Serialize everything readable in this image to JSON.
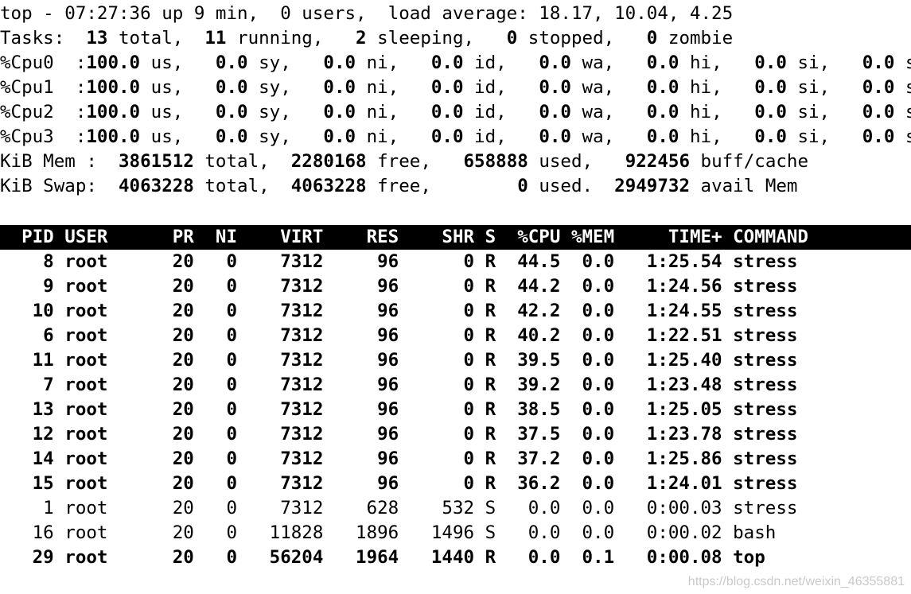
{
  "summary": {
    "uptime_line": "top - 07:27:36 up 9 min,  0 users,  load average: 18.17, 10.04, 4.25",
    "tasks": {
      "label": "Tasks:",
      "total": "13",
      "running": "11",
      "sleeping": "2",
      "stopped": "0",
      "zombie": "0"
    },
    "cpus": [
      {
        "name": "%Cpu0",
        "us": "100.0",
        "sy": "0.0",
        "ni": "0.0",
        "id": "0.0",
        "wa": "0.0",
        "hi": "0.0",
        "si": "0.0",
        "st": "0.0"
      },
      {
        "name": "%Cpu1",
        "us": "100.0",
        "sy": "0.0",
        "ni": "0.0",
        "id": "0.0",
        "wa": "0.0",
        "hi": "0.0",
        "si": "0.0",
        "st": "0.0"
      },
      {
        "name": "%Cpu2",
        "us": "100.0",
        "sy": "0.0",
        "ni": "0.0",
        "id": "0.0",
        "wa": "0.0",
        "hi": "0.0",
        "si": "0.0",
        "st": "0.0"
      },
      {
        "name": "%Cpu3",
        "us": "100.0",
        "sy": "0.0",
        "ni": "0.0",
        "id": "0.0",
        "wa": "0.0",
        "hi": "0.0",
        "si": "0.0",
        "st": "0.0"
      }
    ],
    "mem": {
      "label": "KiB Mem :",
      "total": "3861512",
      "free": "2280168",
      "used": "658888",
      "buff_cache": "922456"
    },
    "swap": {
      "label": "KiB Swap:",
      "total": "4063228",
      "free": "4063228",
      "used": "0",
      "avail_mem": "2949732"
    }
  },
  "process_table": {
    "columns": [
      "PID",
      "USER",
      "PR",
      "NI",
      "VIRT",
      "RES",
      "SHR",
      "S",
      "%CPU",
      "%MEM",
      "TIME+",
      "COMMAND"
    ],
    "rows": [
      {
        "pid": "8",
        "user": "root",
        "pr": "20",
        "ni": "0",
        "virt": "7312",
        "res": "96",
        "shr": "0",
        "s": "R",
        "cpu": "44.5",
        "mem": "0.0",
        "time": "1:25.54",
        "command": "stress",
        "bold": true
      },
      {
        "pid": "9",
        "user": "root",
        "pr": "20",
        "ni": "0",
        "virt": "7312",
        "res": "96",
        "shr": "0",
        "s": "R",
        "cpu": "44.2",
        "mem": "0.0",
        "time": "1:24.56",
        "command": "stress",
        "bold": true
      },
      {
        "pid": "10",
        "user": "root",
        "pr": "20",
        "ni": "0",
        "virt": "7312",
        "res": "96",
        "shr": "0",
        "s": "R",
        "cpu": "42.2",
        "mem": "0.0",
        "time": "1:24.55",
        "command": "stress",
        "bold": true
      },
      {
        "pid": "6",
        "user": "root",
        "pr": "20",
        "ni": "0",
        "virt": "7312",
        "res": "96",
        "shr": "0",
        "s": "R",
        "cpu": "40.2",
        "mem": "0.0",
        "time": "1:22.51",
        "command": "stress",
        "bold": true
      },
      {
        "pid": "11",
        "user": "root",
        "pr": "20",
        "ni": "0",
        "virt": "7312",
        "res": "96",
        "shr": "0",
        "s": "R",
        "cpu": "39.5",
        "mem": "0.0",
        "time": "1:25.40",
        "command": "stress",
        "bold": true
      },
      {
        "pid": "7",
        "user": "root",
        "pr": "20",
        "ni": "0",
        "virt": "7312",
        "res": "96",
        "shr": "0",
        "s": "R",
        "cpu": "39.2",
        "mem": "0.0",
        "time": "1:23.48",
        "command": "stress",
        "bold": true
      },
      {
        "pid": "13",
        "user": "root",
        "pr": "20",
        "ni": "0",
        "virt": "7312",
        "res": "96",
        "shr": "0",
        "s": "R",
        "cpu": "38.5",
        "mem": "0.0",
        "time": "1:25.05",
        "command": "stress",
        "bold": true
      },
      {
        "pid": "12",
        "user": "root",
        "pr": "20",
        "ni": "0",
        "virt": "7312",
        "res": "96",
        "shr": "0",
        "s": "R",
        "cpu": "37.5",
        "mem": "0.0",
        "time": "1:23.78",
        "command": "stress",
        "bold": true
      },
      {
        "pid": "14",
        "user": "root",
        "pr": "20",
        "ni": "0",
        "virt": "7312",
        "res": "96",
        "shr": "0",
        "s": "R",
        "cpu": "37.2",
        "mem": "0.0",
        "time": "1:25.86",
        "command": "stress",
        "bold": true
      },
      {
        "pid": "15",
        "user": "root",
        "pr": "20",
        "ni": "0",
        "virt": "7312",
        "res": "96",
        "shr": "0",
        "s": "R",
        "cpu": "36.2",
        "mem": "0.0",
        "time": "1:24.01",
        "command": "stress",
        "bold": true
      },
      {
        "pid": "1",
        "user": "root",
        "pr": "20",
        "ni": "0",
        "virt": "7312",
        "res": "628",
        "shr": "532",
        "s": "S",
        "cpu": "0.0",
        "mem": "0.0",
        "time": "0:00.03",
        "command": "stress",
        "bold": false
      },
      {
        "pid": "16",
        "user": "root",
        "pr": "20",
        "ni": "0",
        "virt": "11828",
        "res": "1896",
        "shr": "1496",
        "s": "S",
        "cpu": "0.0",
        "mem": "0.0",
        "time": "0:00.02",
        "command": "bash",
        "bold": false
      },
      {
        "pid": "29",
        "user": "root",
        "pr": "20",
        "ni": "0",
        "virt": "56204",
        "res": "1964",
        "shr": "1440",
        "s": "R",
        "cpu": "0.0",
        "mem": "0.1",
        "time": "0:00.08",
        "command": "top",
        "bold": true
      }
    ]
  },
  "watermark": "https://blog.csdn.net/weixin_46355881"
}
